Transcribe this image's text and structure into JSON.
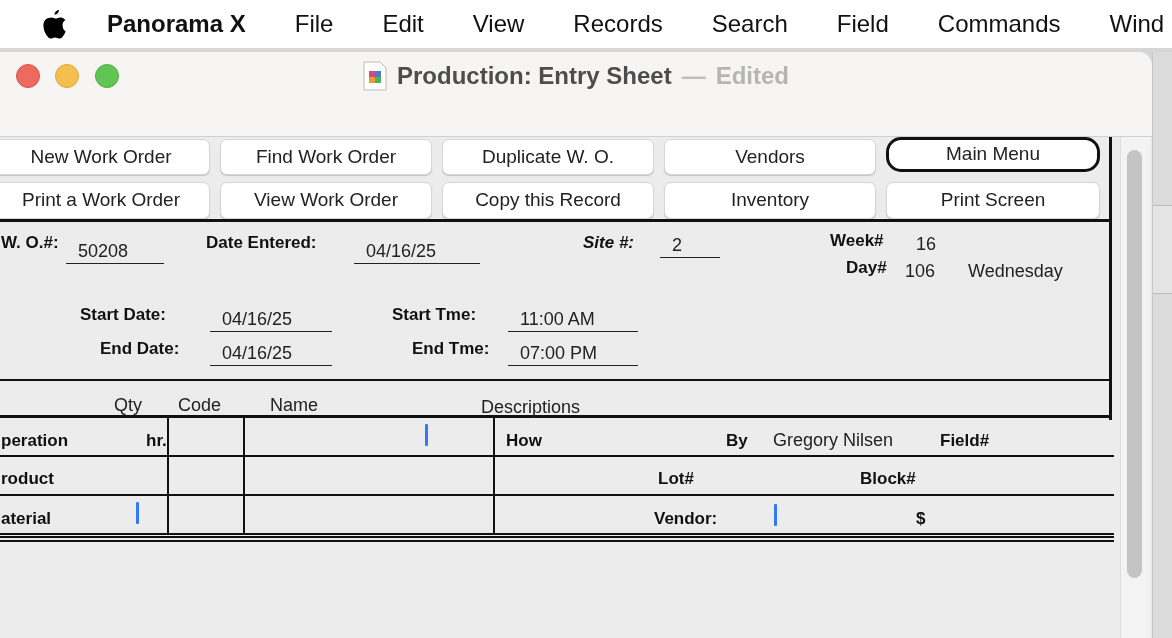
{
  "menubar": {
    "items": [
      {
        "label": "Panorama X",
        "kind": "app"
      },
      {
        "label": "File",
        "kind": "menu"
      },
      {
        "label": "Edit",
        "kind": "menu"
      },
      {
        "label": "View",
        "kind": "menu"
      },
      {
        "label": "Records",
        "kind": "menu"
      },
      {
        "label": "Search",
        "kind": "menu"
      },
      {
        "label": "Field",
        "kind": "menu"
      },
      {
        "label": "Commands",
        "kind": "menu"
      },
      {
        "label": "Wind",
        "kind": "menu"
      }
    ]
  },
  "window": {
    "title": "Production: Entry Sheet",
    "separator": "—",
    "status": "Edited"
  },
  "buttons": [
    {
      "label": "New Work Order",
      "default": false
    },
    {
      "label": "Find Work Order",
      "default": false
    },
    {
      "label": "Duplicate W. O.",
      "default": false
    },
    {
      "label": "Vendors",
      "default": false
    },
    {
      "label": "Main Menu",
      "default": true
    },
    {
      "label": "Print a Work Order",
      "default": false
    },
    {
      "label": "View Work Order",
      "default": false
    },
    {
      "label": "Copy this Record",
      "default": false
    },
    {
      "label": "Inventory",
      "default": false
    },
    {
      "label": "Print Screen",
      "default": false
    }
  ],
  "fields": [
    {
      "label": "W. O.#:",
      "value": "50208",
      "italic": false
    },
    {
      "label": "Date Entered:",
      "value": "04/16/25",
      "italic": false
    },
    {
      "label": "Site #:",
      "value": "2",
      "italic": true
    },
    {
      "label": "Start Date:",
      "value": "04/16/25",
      "italic": false
    },
    {
      "label": "End Date:",
      "value": "04/16/25",
      "italic": false
    },
    {
      "label": "Start Tme:",
      "value": "11:00 AM",
      "italic": false
    },
    {
      "label": "End Tme:",
      "value": "07:00 PM",
      "italic": false
    }
  ],
  "calendar": {
    "week_label": "Week#",
    "week": "16",
    "day_label": "Day#",
    "day": "106",
    "weekday": "Wednesday"
  },
  "columns": [
    "Qty",
    "Code",
    "Name",
    "Descriptions"
  ],
  "rows": [
    {
      "label": "peration",
      "cells": [
        {
          "text": "hr.",
          "bold": true
        },
        {
          "text": "How",
          "bold": true
        },
        {
          "text": "By",
          "bold": true
        },
        {
          "text": "Gregory Nilsen",
          "bold": false
        },
        {
          "text": "Field#",
          "bold": true
        }
      ]
    },
    {
      "label": "roduct",
      "cells": [
        {
          "text": "Lot#",
          "bold": true
        },
        {
          "text": "Block#",
          "bold": true
        }
      ]
    },
    {
      "label": "aterial",
      "cells": [
        {
          "text": "Vendor:",
          "bold": true
        },
        {
          "text": "$",
          "bold": true
        }
      ]
    }
  ]
}
